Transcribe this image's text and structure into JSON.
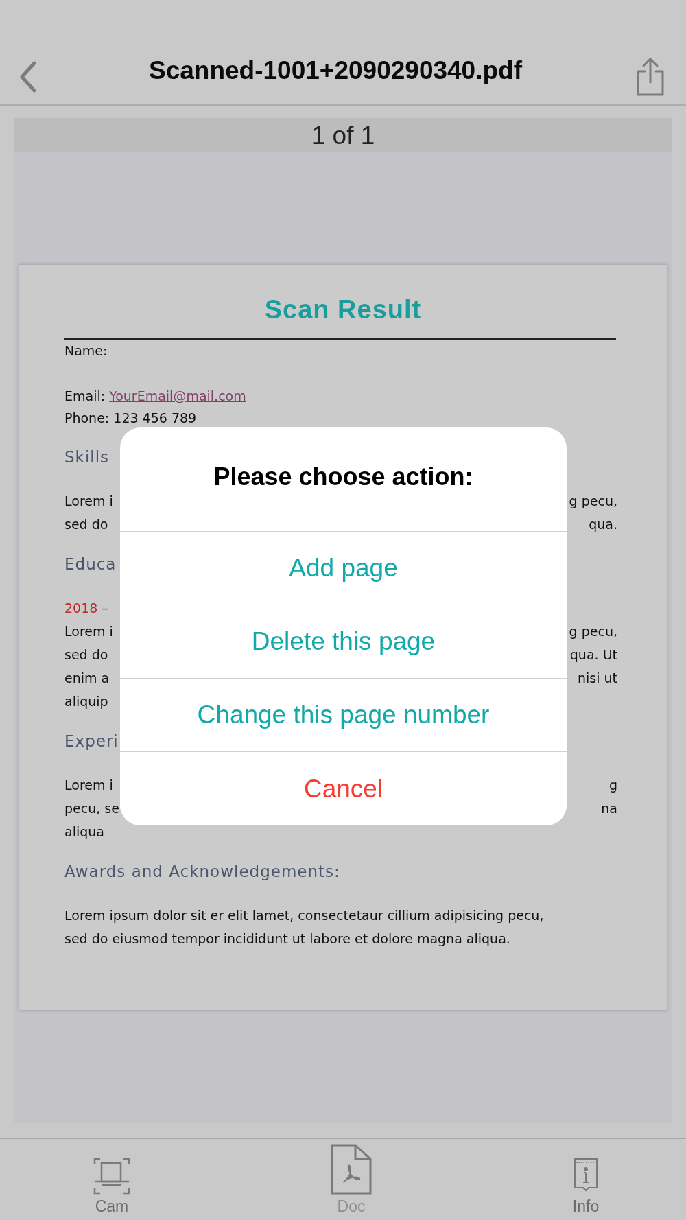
{
  "nav": {
    "title": "Scanned-1001+2090290340.pdf"
  },
  "page_indicator": "1 of 1",
  "document": {
    "title": "Scan Result",
    "blocks": [
      {
        "kind": "field",
        "text": "Name:"
      },
      {
        "kind": "email",
        "label": "Email:",
        "link": "YourEmail@mail.com"
      },
      {
        "kind": "field",
        "text": "Phone: 123 456 789"
      },
      {
        "kind": "heading",
        "text": "Skills"
      },
      {
        "kind": "lines",
        "lines": [
          {
            "left": "Lorem i",
            "right": "g pecu,"
          },
          {
            "left": "sed do",
            "right": "qua."
          }
        ]
      },
      {
        "kind": "heading",
        "text": "Educa"
      },
      {
        "kind": "date",
        "text": "2018 –"
      },
      {
        "kind": "lines",
        "lines": [
          {
            "left": "Lorem i",
            "right": "g pecu,"
          },
          {
            "left": "sed do",
            "right": "qua. Ut"
          },
          {
            "left": "enim a",
            "right": "nisi ut"
          },
          {
            "left": "aliquip"
          }
        ]
      },
      {
        "kind": "heading",
        "text": "Experi"
      },
      {
        "kind": "lines",
        "lines": [
          {
            "left": "Lorem i",
            "right": "g"
          },
          {
            "left": "pecu, se",
            "right": "na"
          },
          {
            "left": "aliqua"
          }
        ]
      },
      {
        "kind": "heading",
        "text": "Awards and Acknowledgements:"
      },
      {
        "kind": "paragraph",
        "text": "Lorem ipsum dolor sit er elit lamet, consectetaur cillium adipisicing pecu, sed do eiusmod tempor incididunt ut labore et dolore magna aliqua."
      }
    ]
  },
  "dialog": {
    "title": "Please choose action:",
    "actions": [
      {
        "label": "Add page",
        "kind": "default"
      },
      {
        "label": "Delete this page",
        "kind": "default"
      },
      {
        "label": "Change this page number",
        "kind": "default"
      },
      {
        "label": "Cancel",
        "kind": "cancel"
      }
    ]
  },
  "tab_bar": [
    {
      "label": "Cam",
      "selected": false
    },
    {
      "label": "Doc",
      "selected": true
    },
    {
      "label": "Info",
      "selected": false
    }
  ]
}
